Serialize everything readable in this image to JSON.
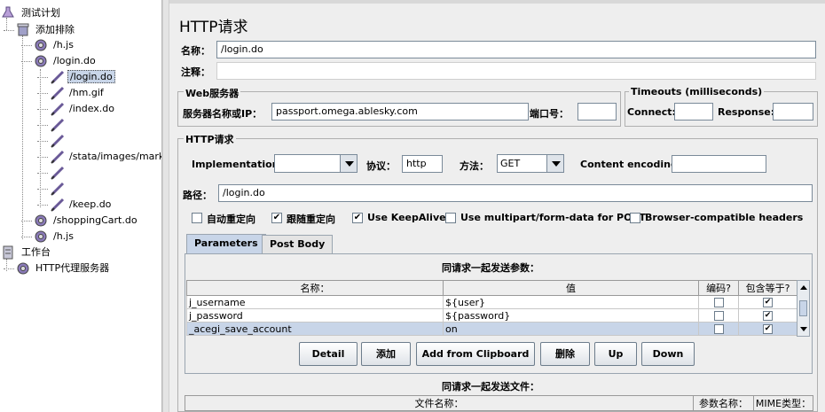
{
  "tree": {
    "items": [
      {
        "label": "测试计划",
        "level": 0,
        "icon": "flask-icon"
      },
      {
        "label": "添加排除",
        "level": 1,
        "icon": "thread-group-icon"
      },
      {
        "label": "/h.js",
        "level": 2,
        "icon": "controller-icon"
      },
      {
        "label": "/login.do",
        "level": 2,
        "icon": "controller-icon"
      },
      {
        "label": "/login.do",
        "level": 3,
        "icon": "sampler-icon",
        "selected": true
      },
      {
        "label": "/hm.gif",
        "level": 3,
        "icon": "sampler-icon"
      },
      {
        "label": "/index.do",
        "level": 3,
        "icon": "sampler-icon"
      },
      {
        "label": "",
        "level": 3,
        "icon": "sampler-icon"
      },
      {
        "label": "",
        "level": 3,
        "icon": "sampler-icon"
      },
      {
        "label": "/stata/images/market/in",
        "level": 3,
        "icon": "sampler-icon"
      },
      {
        "label": "",
        "level": 3,
        "icon": "sampler-icon"
      },
      {
        "label": "",
        "level": 3,
        "icon": "sampler-icon"
      },
      {
        "label": "/keep.do",
        "level": 3,
        "icon": "sampler-icon"
      },
      {
        "label": "/shoppingCart.do",
        "level": 2,
        "icon": "controller-icon"
      },
      {
        "label": "/h.js",
        "level": 2,
        "icon": "controller-icon"
      },
      {
        "label": "工作台",
        "level": 0,
        "icon": "workbench-icon"
      },
      {
        "label": "HTTP代理服务器",
        "level": 1,
        "icon": "proxy-icon"
      }
    ]
  },
  "panel": {
    "title": "HTTP请求",
    "name_label": "名称：",
    "name_value": "/login.do",
    "comment_label": "注释：",
    "comment_value": ""
  },
  "webserver": {
    "group_title": "Web服务器",
    "server_label": "服务器名称或IP：",
    "server_value": "passport.omega.ablesky.com",
    "port_label": "端口号：",
    "port_value": ""
  },
  "timeouts": {
    "group_title": "Timeouts (milliseconds)",
    "connect_label": "Connect:",
    "connect_value": "",
    "response_label": "Response:",
    "response_value": ""
  },
  "http": {
    "group_title": "HTTP请求",
    "impl_label": "Implementation:",
    "impl_value": "",
    "protocol_label": "协议：",
    "protocol_value": "http",
    "method_label": "方法：",
    "method_value": "GET",
    "encoding_label": "Content encoding:",
    "encoding_value": "",
    "path_label": "路径：",
    "path_value": "/login.do"
  },
  "options": [
    {
      "label": "自动重定向",
      "checked": false
    },
    {
      "label": "跟随重定向",
      "checked": true
    },
    {
      "label": "Use KeepAlive",
      "checked": true
    },
    {
      "label": "Use multipart/form-data for POST",
      "checked": false
    },
    {
      "label": "Browser-compatible headers",
      "checked": false
    }
  ],
  "tabs": [
    {
      "label": "Parameters",
      "active": true
    },
    {
      "label": "Post Body",
      "active": false
    }
  ],
  "params": {
    "title": "同请求一起发送参数：",
    "columns": [
      "名称：",
      "值",
      "编码?",
      "包含等于?"
    ],
    "rows": [
      {
        "name": "j_username",
        "value": "${user}",
        "encode": false,
        "include_equals": true
      },
      {
        "name": "j_password",
        "value": "${password}",
        "encode": false,
        "include_equals": true
      },
      {
        "name": "_acegi_save_account",
        "value": "on",
        "encode": false,
        "include_equals": true,
        "selected": true
      }
    ]
  },
  "buttons": {
    "detail": "Detail",
    "add": "添加",
    "clipboard": "Add from Clipboard",
    "delete": "删除",
    "up": "Up",
    "down": "Down"
  },
  "files": {
    "title": "同请求一起发送文件：",
    "columns": [
      "文件名称：",
      "参数名称：",
      "MIME类型："
    ]
  },
  "check_mark": "✔"
}
